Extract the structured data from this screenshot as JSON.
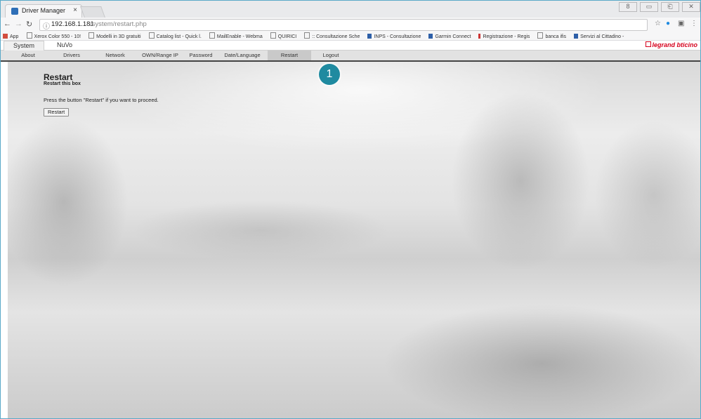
{
  "browser": {
    "tab_title": "Driver Manager",
    "tab_close": "×",
    "url_host": "192.168.1.181",
    "url_path": "/system/restart.php",
    "window_controls": [
      "8",
      "▭",
      "⎗",
      "✕"
    ]
  },
  "bookmarks": [
    {
      "label": "App",
      "icon": "apps-icon"
    },
    {
      "label": "Xerox Color 550 - 10!",
      "icon": "page-icon"
    },
    {
      "label": "Modelli in 3D gratuiti",
      "icon": "cube-icon"
    },
    {
      "label": "Catalog list - Quick l.",
      "icon": "page-icon"
    },
    {
      "label": "MailEnable - Webma",
      "icon": "page-icon"
    },
    {
      "label": "QUIRICI",
      "icon": "page-icon"
    },
    {
      "label": ":: Consultazione Sche",
      "icon": "page-icon"
    },
    {
      "label": "INPS - Consultazione",
      "icon": "inps-icon"
    },
    {
      "label": "Garmin Connect",
      "icon": "garmin-icon"
    },
    {
      "label": "Registrazione - Regis",
      "icon": "flag-icon"
    },
    {
      "label": "banca ifis",
      "icon": "bank-icon"
    },
    {
      "label": "Servizi al Cittadino -",
      "icon": "services-icon"
    }
  ],
  "app": {
    "top_tabs": [
      "System",
      "NuVo"
    ],
    "active_top_tab": "System",
    "logo_brand1": "legrand",
    "logo_brand2": "bticino",
    "menu": [
      "About",
      "Drivers",
      "Network",
      "OWN/Range IP",
      "Password",
      "Date/Language",
      "Restart",
      "Logout"
    ],
    "active_menu": "Restart"
  },
  "content": {
    "title": "Restart",
    "subtitle": "Restart this box",
    "instruction": "Press the button \"Restart\" if you want to proceed.",
    "button_label": "Restart"
  },
  "callout": {
    "number": "1",
    "color": "#1f8aa0"
  },
  "colors": {
    "legrand_red": "#d6001c",
    "menu_bg": "#e2e2e2",
    "active_menu_bg": "#c9c9c9"
  }
}
